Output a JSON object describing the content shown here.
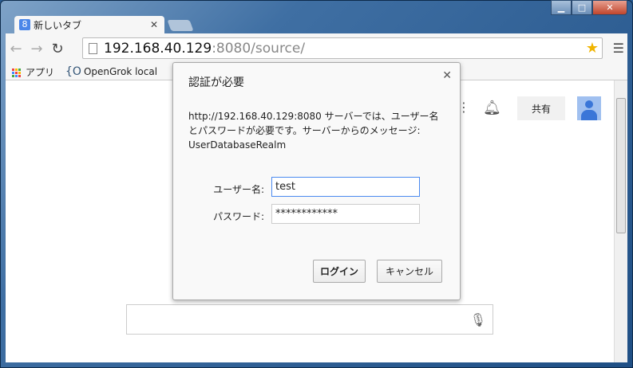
{
  "tab": {
    "title": "新しいタブ",
    "favicon": "8"
  },
  "omnibox": {
    "host": "192.168.40.129",
    "rest": ":8080/source/"
  },
  "bookmarks": [
    {
      "label": "アプリ"
    },
    {
      "label": "OpenGrok local",
      "icon": "{O"
    }
  ],
  "page": {
    "share_label": "共有"
  },
  "dialog": {
    "title": "認証が必要",
    "message_line1": "http://192.168.40.129:8080 サーバーでは、ユーザー名",
    "message_line2": "とパスワードが必要です。サーバーからのメッセージ:",
    "message_line3": "UserDatabaseRealm",
    "username_label": "ユーザー名:",
    "username_value": "test",
    "password_label": "パスワード:",
    "password_value": "************",
    "login_label": "ログイン",
    "cancel_label": "キャンセル"
  }
}
